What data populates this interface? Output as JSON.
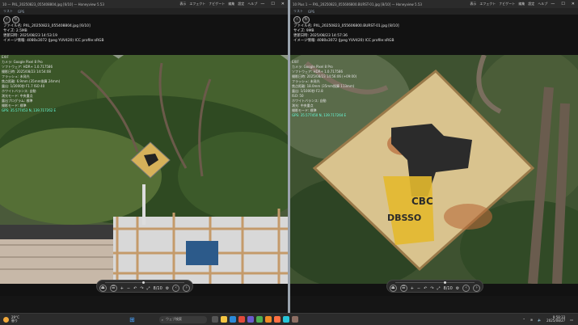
{
  "left_window": {
    "title": "10 — PXL_20250823_055408804.jpg [6/10] — Honeyview 5.53",
    "menus": [
      "表示",
      "エフェクト",
      "ナビゲート",
      "編集",
      "設定",
      "ヘルプ"
    ],
    "toolbar": [
      "リスト",
      "GPS"
    ],
    "info": [
      "ファイル名: PXL_20250823_055408804.jpg [6/10]",
      "サイズ: 2.5MB",
      "更新日時: 2025/08/23 14:53:19",
      "イメージ情報: 4080x3072 (Jpeg YUV420) ICC profile:sRGB"
    ],
    "exif_heading": "EXIF",
    "exif": [
      "カメラ: Google Pixel 8 Pro",
      "ソフトウェア: HDR+ 1.0.717586",
      "撮影日時: 2025/08/23 14:54:08",
      "フラッシュ: 未発光",
      "焦点距離: 6.9mm (35mm換算 24mm)",
      "露出: 1/2000秒  F1.7  ISO 40",
      "ホワイトバランス: 自動",
      "測光モード: 中央重点",
      "露出プログラム: 標準",
      "撮影モード: 標準",
      "GPS: 35.577453 N, 139.717262 E"
    ],
    "exif_highlight": "GPS: 35.577453 N, 139.717262 E",
    "controls": [
      "⏏",
      "☰",
      "+",
      "−",
      "↶",
      "↷",
      "⤢",
      "8/10",
      "⚙"
    ]
  },
  "right_window": {
    "title": "10 Plus 1 — PXL_20250823_055606800.BURST-01.jpg [8/10] — Honeyview 5.53",
    "menus": [
      "表示",
      "エフェクト",
      "ナビゲート",
      "編集",
      "設定",
      "ヘルプ"
    ],
    "toolbar": [
      "リスト",
      "GPS"
    ],
    "info": [
      "ファイル名: PXL_20250823_055606800.BURST-01.jpg [8/10]",
      "サイズ: 9MB",
      "更新日時: 2025/08/23 14:57:36",
      "イメージ情報: 4080x3072 (Jpeg YUV420) ICC profile:sRGB"
    ],
    "exif_heading": "EXIF",
    "exif": [
      "カメラ: Google Pixel 8 Pro",
      "ソフトウェア: HDR+ 1.0.717586",
      "撮影日時: 2025/08/23 14:56:06 (+09:00)",
      "フラッシュ: 未発光",
      "焦点距離: 18.0mm (35mm換算 113mm)",
      "露出: 1/1000秒 F2.8",
      "ISO: 50",
      "ホワイトバランス: 自動",
      "測光: 中央重点",
      "撮影モード: 標準",
      "GPS: 35.577450 N, 139.717264 E"
    ],
    "exif_highlight": "GPS: 35.577450 N, 139.717264 E",
    "controls": [
      "⏏",
      "☰",
      "+",
      "−",
      "↶",
      "↷",
      "⤢",
      "8/10",
      "⚙"
    ]
  },
  "taskbar": {
    "weather_temp": "29°C",
    "weather_text": "曇り",
    "search_placeholder": "ウェブ検索",
    "time": "9:58:33",
    "date": "2025/08/27"
  },
  "colors": {
    "highlight": "#66ffdd",
    "sign": "#d9c38e",
    "foliage": "#3d5a2c"
  }
}
